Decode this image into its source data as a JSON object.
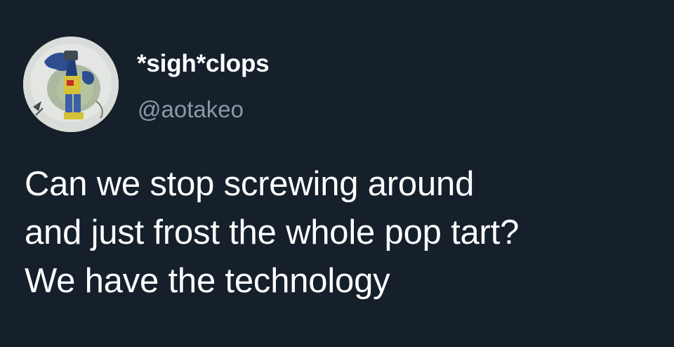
{
  "tweet": {
    "author": {
      "display_name": "*sigh*clops",
      "handle": "@aotakeo",
      "avatar": "avatar"
    },
    "text_lines": [
      "Can we stop screwing around",
      "and just frost the whole pop tart?",
      "We have the technology"
    ]
  },
  "colors": {
    "background": "#15202b",
    "primary_text": "#ffffff",
    "secondary_text": "#8899a6"
  }
}
